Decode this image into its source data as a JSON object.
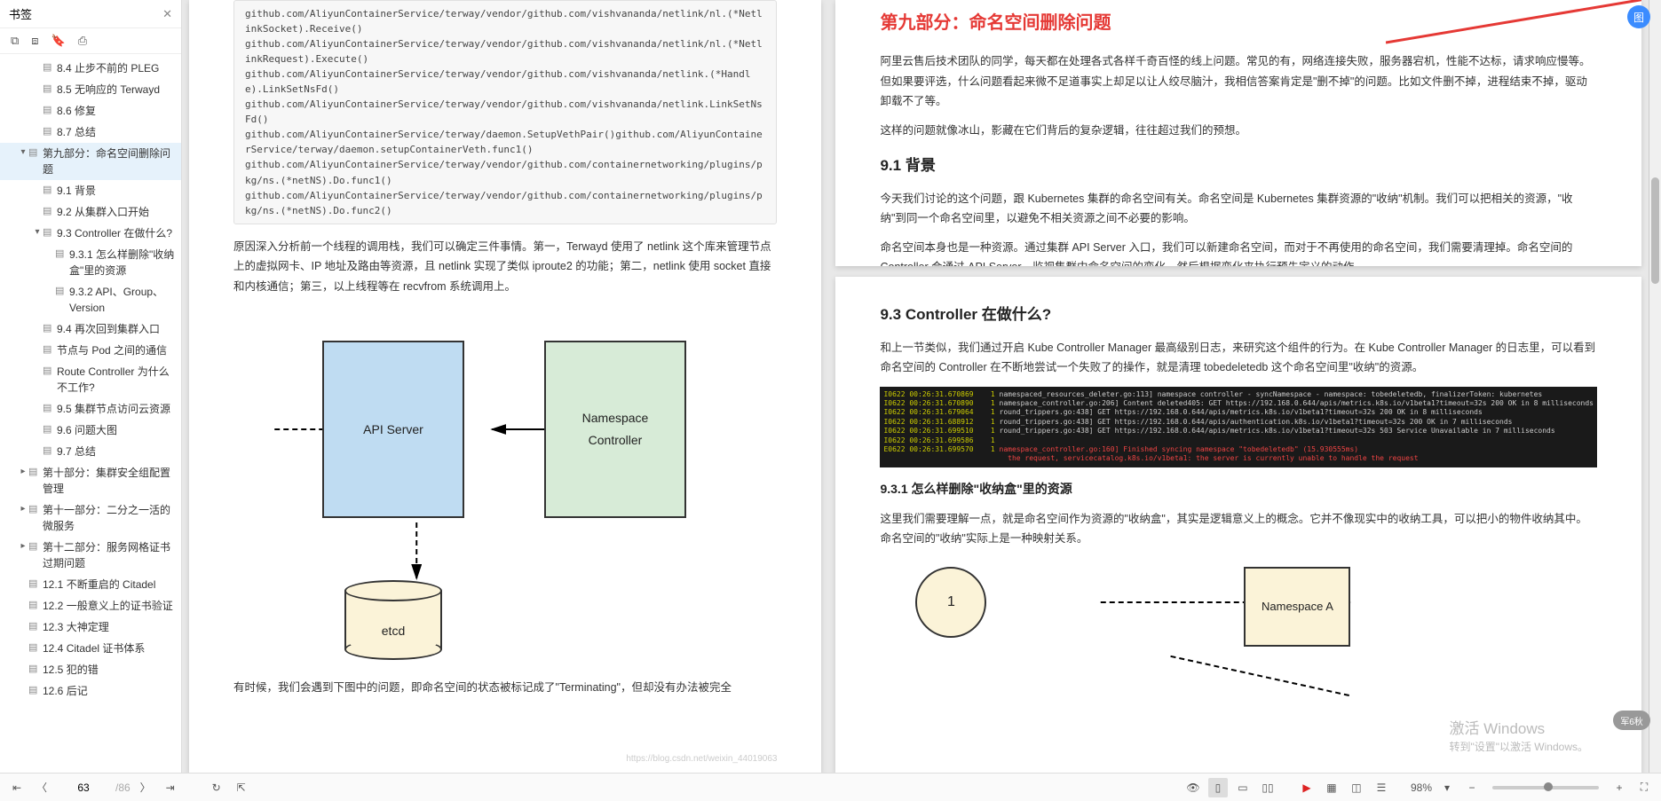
{
  "sidebar": {
    "title": "书签",
    "closeIcon": "✕",
    "toolbarIcons": [
      "two-page-icon",
      "single-page-icon",
      "bookmark-icon",
      "bookmark-add-icon"
    ],
    "items": [
      {
        "level": 2,
        "label": "8.4 止步不前的 PLEG"
      },
      {
        "level": 2,
        "label": "8.5 无响应的 Terwayd"
      },
      {
        "level": 2,
        "label": "8.6 修复"
      },
      {
        "level": 2,
        "label": "8.7 总结"
      },
      {
        "level": 1,
        "label": "第九部分：命名空间删除问题",
        "active": true,
        "arrow": "▾"
      },
      {
        "level": 2,
        "label": "9.1 背景"
      },
      {
        "level": 2,
        "label": "9.2 从集群入口开始"
      },
      {
        "level": 2,
        "label": "9.3 Controller 在做什么?",
        "arrow": "▾"
      },
      {
        "level": 3,
        "label": "9.3.1 怎么样删除\"收纳盒\"里的资源"
      },
      {
        "level": 3,
        "label": "9.3.2 API、Group、Version"
      },
      {
        "level": 2,
        "label": "9.4 再次回到集群入口"
      },
      {
        "level": 2,
        "label": "节点与 Pod 之间的通信"
      },
      {
        "level": 2,
        "label": "Route Controller 为什么不工作?"
      },
      {
        "level": 2,
        "label": "9.5 集群节点访问云资源"
      },
      {
        "level": 2,
        "label": "9.6 问题大图"
      },
      {
        "level": 2,
        "label": "9.7 总结"
      },
      {
        "level": 1,
        "label": "第十部分：集群安全组配置管理",
        "arrow": "▸"
      },
      {
        "level": 1,
        "label": "第十一部分：二分之一活的微服务",
        "arrow": "▸"
      },
      {
        "level": 1,
        "label": "第十二部分：服务网格证书过期问题",
        "arrow": "▸"
      },
      {
        "level": 1,
        "label": "12.1 不断重启的 Citadel"
      },
      {
        "level": 1,
        "label": "12.2 一般意义上的证书验证"
      },
      {
        "level": 1,
        "label": "12.3 大神定理"
      },
      {
        "level": 1,
        "label": "12.4 Citadel 证书体系"
      },
      {
        "level": 1,
        "label": "12.5 犯的错"
      },
      {
        "level": 1,
        "label": "12.6 后记"
      }
    ]
  },
  "pageLeft": {
    "codeLines": [
      "github.com/AliyunContainerService/terway/vendor/github.com/vishvananda/netlink/nl.(*NetlinkSocket).Receive()",
      "github.com/AliyunContainerService/terway/vendor/github.com/vishvananda/netlink/nl.(*NetlinkRequest).Execute()",
      "github.com/AliyunContainerService/terway/vendor/github.com/vishvananda/netlink.(*Handle).LinkSetNsFd()",
      "github.com/AliyunContainerService/terway/vendor/github.com/vishvananda/netlink.LinkSetNsFd()",
      "github.com/AliyunContainerService/terway/daemon.SetupVethPair()github.com/AliyunContainerService/terway/daemon.setupContainerVeth.func1()",
      "github.com/AliyunContainerService/terway/vendor/github.com/containernetworking/plugins/pkg/ns.(*netNS).Do.func1()",
      "github.com/AliyunContainerService/terway/vendor/github.com/containernetworking/plugins/pkg/ns.(*netNS).Do.func2()"
    ],
    "para1": "原因深入分析前一个线程的调用栈，我们可以确定三件事情。第一，Terwayd 使用了 netlink 这个库来管理节点上的虚拟网卡、IP 地址及路由等资源，且 netlink 实现了类似 iproute2 的功能；第二，netlink 使用 socket 直接和内核通信；第三，以上线程等在 recvfrom 系统调用上。",
    "para2": "有时候，我们会遇到下图中的问题，即命名空间的状态被标记成了\"Terminating\"，但却没有办法被完全",
    "diagram": {
      "api": "API Server",
      "ns1": "Namespace",
      "ns2": "Controller",
      "etcd": "etcd"
    },
    "watermark": "https://blog.csdn.net/weixin_44019063"
  },
  "pageRight": {
    "title": "第九部分：命名空间删除问题",
    "p1": "阿里云售后技术团队的同学，每天都在处理各式各样千奇百怪的线上问题。常见的有，网络连接失败，服务器宕机，性能不达标，请求响应慢等。但如果要评选，什么问题看起来微不足道事实上却足以让人绞尽脑汁，我相信答案肯定是\"删不掉\"的问题。比如文件删不掉，进程结束不掉，驱动卸载不了等。",
    "p2": "这样的问题就像冰山，影藏在它们背后的复杂逻辑，往往超过我们的预想。",
    "h91": "9.1 背景",
    "p3": "今天我们讨论的这个问题，跟 Kubernetes 集群的命名空间有关。命名空间是 Kubernetes 集群资源的\"收纳\"机制。我们可以把相关的资源，\"收纳\"到同一个命名空间里，以避免不相关资源之间不必要的影响。",
    "p4": "命名空间本身也是一种资源。通过集群 API Server 入口，我们可以新建命名空间，而对于不再使用的命名空间，我们需要清理掉。命名空间的 Controller 会通过 API Server，监视集群中命名空间的变化，然后根据变化来执行预先定义的动作。",
    "h93": "9.3 Controller 在做什么?",
    "p5": "和上一节类似，我们通过开启 Kube Controller Manager 最高级别日志，来研究这个组件的行为。在 Kube Controller Manager 的日志里，可以看到命名空间的 Controller 在不断地尝试一个失败了的操作，就是清理 tobedeletedb 这个命名空间里\"收纳\"的资源。",
    "h931": "9.3.1 怎么样删除\"收纳盒\"里的资源",
    "p6": "这里我们需要理解一点，就是命名空间作为资源的\"收纳盒\"，其实是逻辑意义上的概念。它并不像现实中的收纳工具，可以把小的物件收纳其中。命名空间的\"收纳\"实际上是一种映射关系。",
    "diagram2": {
      "circle": "1",
      "box": "Namespace A"
    },
    "logText": "I0622 00:26:31.670869    1 namespaced_resources_deleter.go:113] namespace controller - syncNamespace - namespace: tobedeletedb, finalizerToken: kubernetes\nI0622 00:26:31.670890    1 namespace_controller.go:206] Content deleted405: GET https://192.168.0.644/apis/metrics.k8s.io/v1beta1?timeout=32s 200 OK in 8 milliseconds\nI0622 00:26:31.679064    1 round_trippers.go:438] GET https://192.168.0.644/apis/metrics.k8s.io/v1beta1?timeout=32s 200 OK in 8 milliseconds\nI0622 00:26:31.688912    1 round_trippers.go:438] GET https://192.168.0.644/apis/authentication.k8s.io/v1beta1?timeout=32s 200 OK in 7 milliseconds\nI0622 00:26:31.699510    1 round_trippers.go:438] GET https://192.168.0.644/apis/metrics.k8s.io/v1beta1?timeout=32s 503 Service Unavailable in 7 milliseconds\nI0622 00:26:31.699586    1\nE0622 00:26:31.699570    1 namespace_controller.go:160] Finished syncing namespace \"tobedeletedb\" (15.930555ms)\n                             the request, servicecatalog.k8s.io/v1beta1: the server is currently unable to handle the request",
    "watermarkAct1": "激活 Windows",
    "watermarkAct2": "转到\"设置\"以激活 Windows。"
  },
  "footer": {
    "pageCurrent": "63",
    "pageTotal": "/86",
    "zoomLabel": "98%"
  },
  "floatBadge": "军6秋"
}
